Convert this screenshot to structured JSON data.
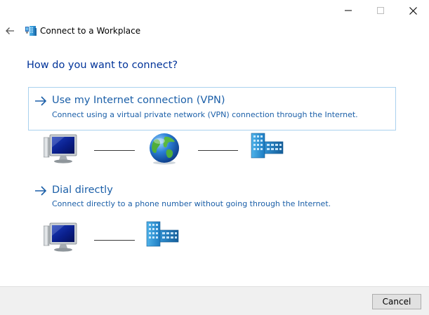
{
  "window": {
    "title": "Connect to a Workplace",
    "controls": {
      "minimize": "minimize-icon",
      "maximize": "maximize-icon",
      "close": "close-icon"
    },
    "back_icon": "back-arrow-icon"
  },
  "heading": "How do you want to connect?",
  "options": [
    {
      "title": "Use my Internet connection (VPN)",
      "description": "Connect using a virtual private network (VPN) connection through the Internet.",
      "selected": true,
      "illustration": [
        "computer-icon",
        "globe-icon",
        "workplace-building-icon"
      ]
    },
    {
      "title": "Dial directly",
      "description": "Connect directly to a phone number without going through the Internet.",
      "selected": false,
      "illustration": [
        "computer-icon",
        "workplace-building-icon"
      ]
    }
  ],
  "footer": {
    "cancel_label": "Cancel"
  },
  "colors": {
    "heading": "#003399",
    "link": "#1b5fa8",
    "selection_border": "#a9d1ee",
    "footer_bg": "#f0f0f0"
  }
}
